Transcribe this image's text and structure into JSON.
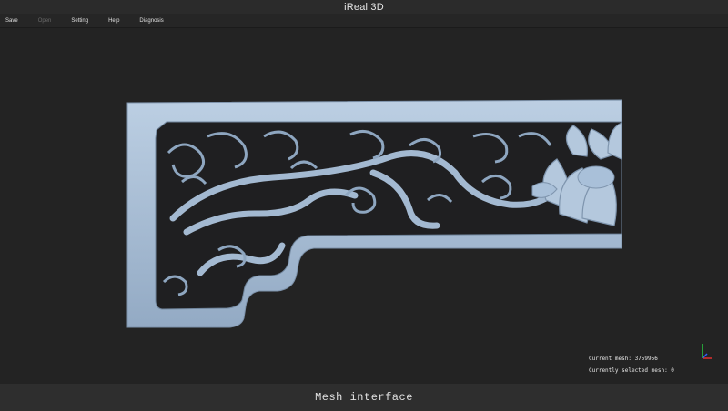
{
  "window": {
    "title": "iReal 3D"
  },
  "menu": {
    "items": [
      {
        "label": "Save",
        "enabled": true
      },
      {
        "label": "Open",
        "enabled": false
      },
      {
        "label": "Setting",
        "enabled": true
      },
      {
        "label": "Help",
        "enabled": true
      },
      {
        "label": "Diagnosis",
        "enabled": true
      }
    ]
  },
  "viewport": {
    "mesh_color": "#a9c0d9",
    "background_color": "#232323",
    "status": {
      "current_mesh": "Current mesh: 3759956",
      "selected_mesh": "Currently selected mesh: 0"
    },
    "axis_icon": "xyz-axis-triad"
  },
  "caption": "Mesh interface"
}
